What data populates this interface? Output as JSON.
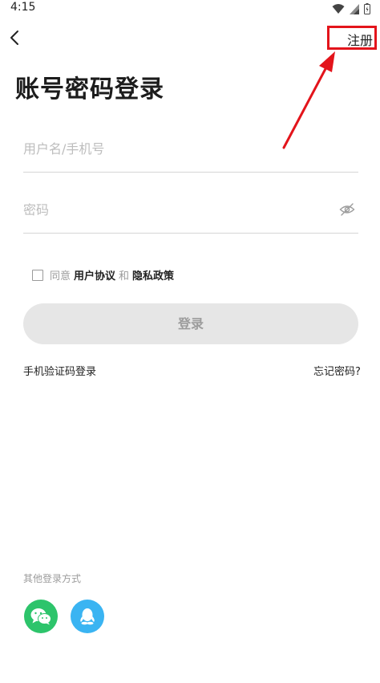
{
  "statusbar": {
    "time": "4:15"
  },
  "header": {
    "register_label": "注册"
  },
  "title": "账号密码登录",
  "form": {
    "username_placeholder": "用户名/手机号",
    "password_placeholder": "密码"
  },
  "agreement": {
    "prefix": "同意",
    "user_agreement": "用户协议",
    "and": "和",
    "privacy_policy": "隐私政策"
  },
  "login_button": "登录",
  "links": {
    "sms_login": "手机验证码登录",
    "forgot_password": "忘记密码?"
  },
  "other_login": {
    "label": "其他登录方式",
    "icons": [
      "wechat-icon",
      "qq-icon"
    ]
  },
  "colors": {
    "annotation_red": "#e3141b",
    "wechat_green": "#2dc46b",
    "qq_blue": "#3ab4f2",
    "button_disabled_bg": "#e6e6e6"
  }
}
